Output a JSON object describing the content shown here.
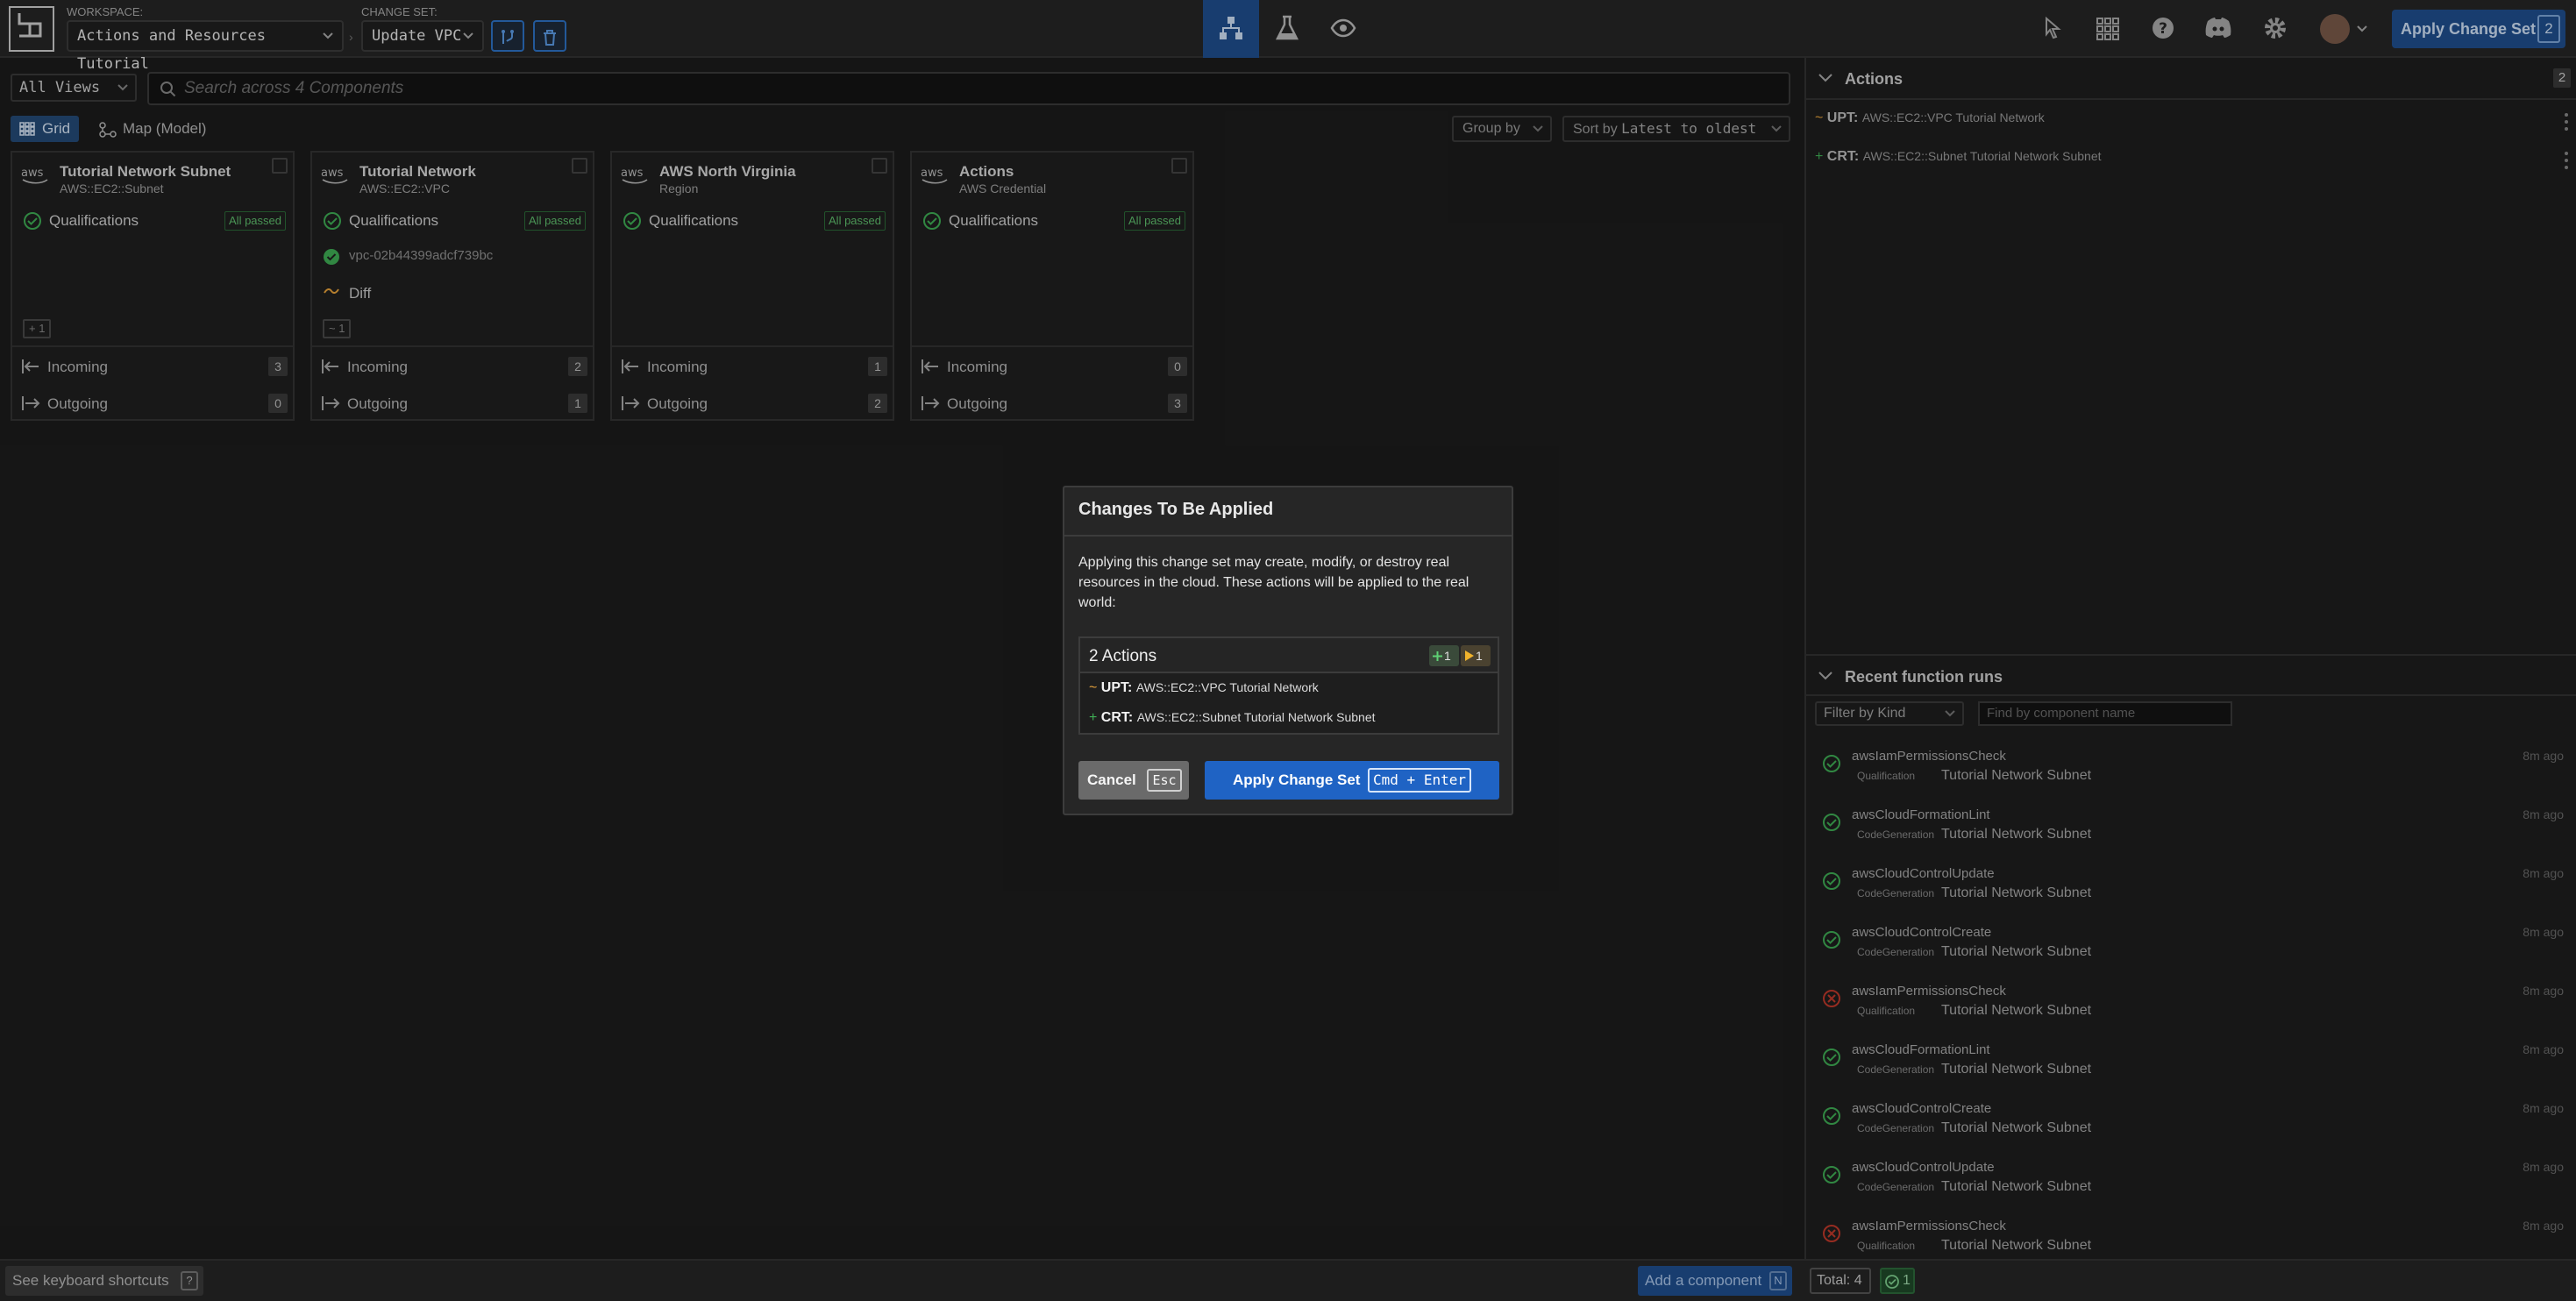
{
  "header": {
    "workspace_label": "WORKSPACE:",
    "workspace_value": "Actions and Resources Tutorial",
    "changeset_label": "CHANGE SET:",
    "changeset_value": "Update VPC",
    "apply_label": "Apply Change Set",
    "apply_count": "2"
  },
  "toolbar": {
    "views_value": "All Views",
    "search_placeholder": "Search across 4 Components",
    "grid_label": "Grid",
    "map_label": "Map (Model)",
    "groupby_label": "Group by",
    "sort_prefix": "Sort by",
    "sort_value": "Latest to oldest"
  },
  "cards": [
    {
      "title": "Tutorial Network Subnet",
      "subtitle": "AWS::EC2::Subnet",
      "qual_label": "Qualifications",
      "qual_badge": "All passed",
      "diff_badge": "+ 1",
      "incoming_label": "Incoming",
      "incoming_count": "3",
      "outgoing_label": "Outgoing",
      "outgoing_count": "0"
    },
    {
      "title": "Tutorial Network",
      "subtitle": "AWS::EC2::VPC",
      "qual_label": "Qualifications",
      "qual_badge": "All passed",
      "resource_id": "vpc-02b44399adcf739bc",
      "diff_label": "Diff",
      "diff_badge": "~ 1",
      "incoming_label": "Incoming",
      "incoming_count": "2",
      "outgoing_label": "Outgoing",
      "outgoing_count": "1"
    },
    {
      "title": "AWS North Virginia",
      "subtitle": "Region",
      "qual_label": "Qualifications",
      "qual_badge": "All passed",
      "incoming_label": "Incoming",
      "incoming_count": "1",
      "outgoing_label": "Outgoing",
      "outgoing_count": "2"
    },
    {
      "title": "Actions",
      "subtitle": "AWS Credential",
      "qual_label": "Qualifications",
      "qual_badge": "All passed",
      "incoming_label": "Incoming",
      "incoming_count": "0",
      "outgoing_label": "Outgoing",
      "outgoing_count": "3"
    }
  ],
  "actions_panel": {
    "title": "Actions",
    "count": "2",
    "items": [
      {
        "kind": "UPT:",
        "target": "AWS::EC2::VPC Tutorial Network"
      },
      {
        "kind": "CRT:",
        "target": "AWS::EC2::Subnet Tutorial Network Subnet"
      }
    ]
  },
  "function_runs": {
    "title": "Recent function runs",
    "filter_value": "Filter by Kind",
    "search_placeholder": "Find by component name",
    "items": [
      {
        "name": "awsIamPermissionsCheck",
        "kind": "Qualification",
        "component": "Tutorial Network Subnet",
        "time": "8m ago",
        "status": "success"
      },
      {
        "name": "awsCloudFormationLint",
        "kind": "CodeGeneration",
        "component": "Tutorial Network Subnet",
        "time": "8m ago",
        "status": "success"
      },
      {
        "name": "awsCloudControlUpdate",
        "kind": "CodeGeneration",
        "component": "Tutorial Network Subnet",
        "time": "8m ago",
        "status": "success"
      },
      {
        "name": "awsCloudControlCreate",
        "kind": "CodeGeneration",
        "component": "Tutorial Network Subnet",
        "time": "8m ago",
        "status": "success"
      },
      {
        "name": "awsIamPermissionsCheck",
        "kind": "Qualification",
        "component": "Tutorial Network Subnet",
        "time": "8m ago",
        "status": "failure"
      },
      {
        "name": "awsCloudFormationLint",
        "kind": "CodeGeneration",
        "component": "Tutorial Network Subnet",
        "time": "8m ago",
        "status": "success"
      },
      {
        "name": "awsCloudControlCreate",
        "kind": "CodeGeneration",
        "component": "Tutorial Network Subnet",
        "time": "8m ago",
        "status": "success"
      },
      {
        "name": "awsCloudControlUpdate",
        "kind": "CodeGeneration",
        "component": "Tutorial Network Subnet",
        "time": "8m ago",
        "status": "success"
      },
      {
        "name": "awsIamPermissionsCheck",
        "kind": "Qualification",
        "component": "Tutorial Network Subnet",
        "time": "8m ago",
        "status": "failure"
      }
    ]
  },
  "bottom": {
    "shortcuts_label": "See keyboard shortcuts",
    "shortcuts_key": "?",
    "add_label": "Add a component",
    "add_key": "N",
    "total_label": "Total: 4",
    "ok_count": "1"
  },
  "modal": {
    "title": "Changes To Be Applied",
    "body": "Applying this change set may create, modify, or destroy real resources in the cloud. These actions will be applied to the real world:",
    "list_title": "2 Actions",
    "create_count": "1",
    "update_count": "1",
    "items": [
      {
        "kind": "UPT:",
        "target": "AWS::EC2::VPC Tutorial Network"
      },
      {
        "kind": "CRT:",
        "target": "AWS::EC2::Subnet Tutorial Network Subnet"
      }
    ],
    "cancel_label": "Cancel",
    "cancel_key": "Esc",
    "apply_label": "Apply Change Set",
    "apply_key": "Cmd + Enter"
  },
  "colors": {
    "accent_blue": "#1f63c4",
    "success_green": "#3fae55",
    "failure_red": "#c0392b",
    "update_orange": "#e8a33c"
  }
}
